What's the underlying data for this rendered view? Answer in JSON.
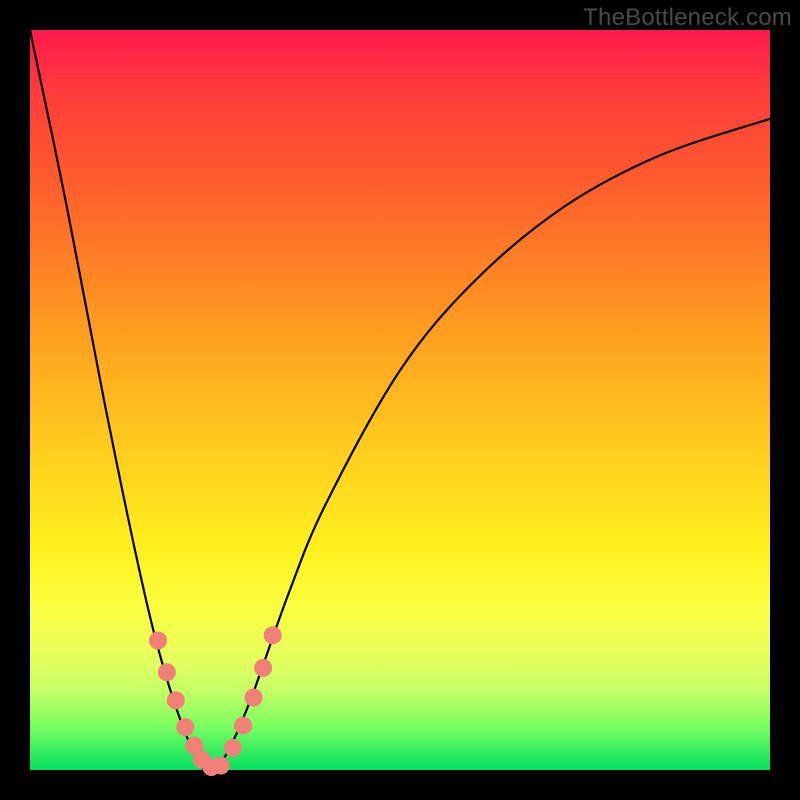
{
  "watermark": "TheBottleneck.com",
  "chart_data": {
    "type": "line",
    "title": "",
    "xlabel": "",
    "ylabel": "",
    "xlim": [
      0,
      1
    ],
    "ylim": [
      0,
      100
    ],
    "series": [
      {
        "name": "bottleneck-curve",
        "x": [
          0.0,
          0.05,
          0.1,
          0.15,
          0.18,
          0.21,
          0.235,
          0.25,
          0.27,
          0.3,
          0.35,
          0.4,
          0.5,
          0.6,
          0.72,
          0.85,
          1.0
        ],
        "y": [
          100,
          76,
          50,
          26,
          14,
          5,
          0,
          0,
          3,
          10,
          24,
          36,
          54,
          66,
          76,
          83,
          88
        ]
      }
    ],
    "markers": {
      "name": "highlight-points",
      "x": [
        0.173,
        0.185,
        0.197,
        0.21,
        0.222,
        0.232,
        0.245,
        0.258,
        0.274,
        0.288,
        0.302,
        0.315,
        0.328
      ],
      "y": [
        17.5,
        13.2,
        9.4,
        5.8,
        3.3,
        1.4,
        0.4,
        0.6,
        3.0,
        6.0,
        9.8,
        13.8,
        18.2
      ],
      "color": "#f08078",
      "radius": 9
    },
    "gradient_stops": [
      {
        "pos": 0.0,
        "color": "#ff1a4d"
      },
      {
        "pos": 0.35,
        "color": "#ff8c22"
      },
      {
        "pos": 0.7,
        "color": "#fff01e"
      },
      {
        "pos": 1.0,
        "color": "#00e060"
      }
    ]
  }
}
